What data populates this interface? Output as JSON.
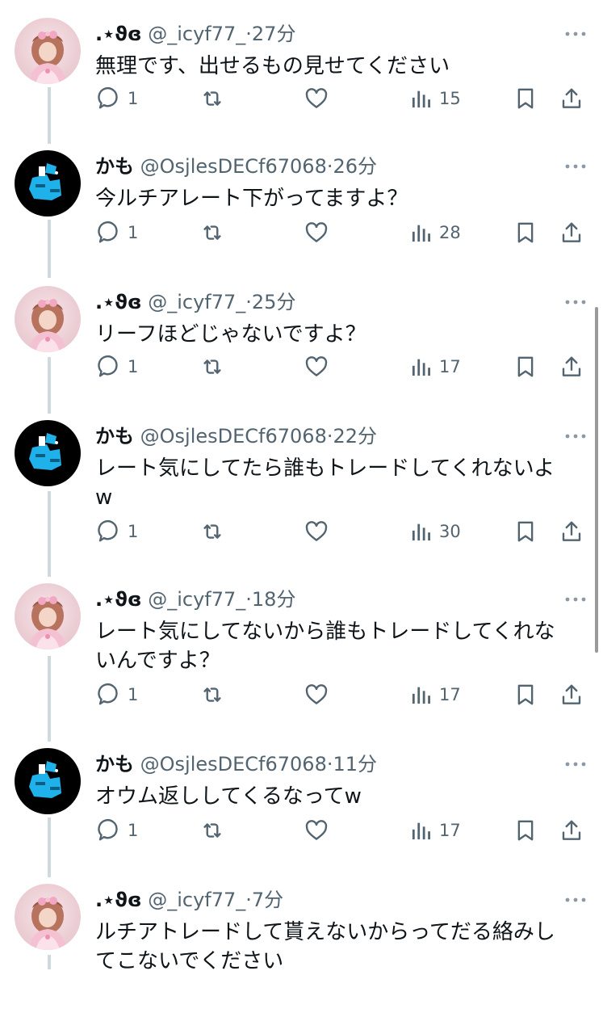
{
  "posts": [
    {
      "avatar": "girl-avatar",
      "name": ".⋆ϑɞ",
      "handle": "@_icyf77_",
      "dot": "·",
      "time": "27分",
      "lines": [
        "無理です、出せるもの見せてください"
      ],
      "replies": "1",
      "views": "15"
    },
    {
      "avatar": "kamo-avatar",
      "name": "かも",
      "handle": "@OsjlesDECf67068",
      "dot": "·",
      "time": "26分",
      "lines": [
        "今ルチアレート下がってますよ？"
      ],
      "replies": "1",
      "views": "28"
    },
    {
      "avatar": "girl-avatar",
      "name": ".⋆ϑɞ",
      "handle": "@_icyf77_",
      "dot": "·",
      "time": "25分",
      "lines": [
        "リーフほどじゃないですよ？"
      ],
      "replies": "1",
      "views": "17"
    },
    {
      "avatar": "kamo-avatar",
      "name": "かも",
      "handle": "@OsjlesDECf67068",
      "dot": "·",
      "time": "22分",
      "lines": [
        "レート気にしてたら誰もトレードしてくれないよ",
        "w"
      ],
      "replies": "1",
      "views": "30"
    },
    {
      "avatar": "girl-avatar",
      "name": ".⋆ϑɞ",
      "handle": "@_icyf77_",
      "dot": "·",
      "time": "18分",
      "lines": [
        "レート気にしてないから誰もトレードしてくれな",
        "いんですよ？"
      ],
      "replies": "1",
      "views": "17"
    },
    {
      "avatar": "kamo-avatar",
      "name": "かも",
      "handle": "@OsjlesDECf67068",
      "dot": "·",
      "time": "11分",
      "lines": [
        "オウム返ししてくるなってw"
      ],
      "replies": "1",
      "views": "17"
    },
    {
      "avatar": "girl-avatar",
      "name": ".⋆ϑɞ",
      "handle": "@_icyf77_",
      "dot": "·",
      "time": "7分",
      "lines": [
        "ルチアトレードして貰えないからってだる絡みし",
        "てこないでください"
      ],
      "replies": null,
      "views": null
    }
  ]
}
